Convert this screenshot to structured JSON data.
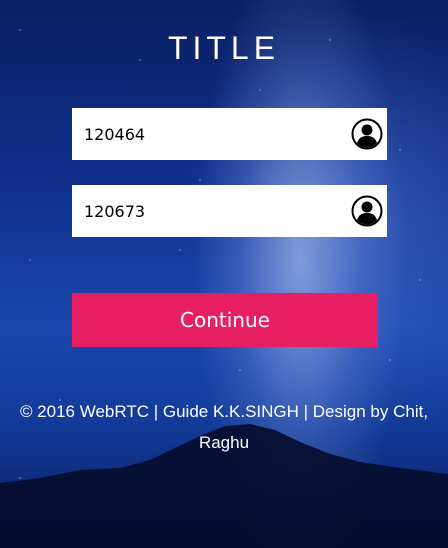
{
  "page": {
    "title": "TITLE"
  },
  "form": {
    "field1": {
      "value": "120464",
      "icon": "user-circle-icon"
    },
    "field2": {
      "value": "120673",
      "icon": "user-circle-icon"
    },
    "continue_label": "Continue"
  },
  "footer": {
    "text": "© 2016 WebRTC | Guide K.K.SINGH | Design by Chit, Raghu"
  },
  "colors": {
    "button": "#e81e63",
    "background": "#123a98"
  }
}
